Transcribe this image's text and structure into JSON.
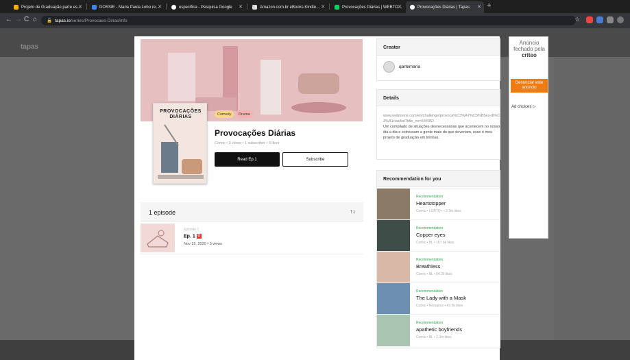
{
  "browser": {
    "tabs": [
      {
        "title": "Projeto de Graduação parte es…",
        "color": "#f4b400"
      },
      {
        "title": "DOSSIE - Maria Paula Lobo re…",
        "color": "#4285f4"
      },
      {
        "title": "especifica - Pesquisa Google",
        "color": "#ffffff"
      },
      {
        "title": "Amazon.com.br eBooks Kindle…",
        "color": "#222222"
      },
      {
        "title": "Provocações Diárias | WEBTO…",
        "color": "#00d564"
      },
      {
        "title": "Provocações Diárias | Tapas",
        "color": "#ffffff"
      }
    ],
    "new_tab": "+",
    "address_host": "tapas.io",
    "address_path": "/series/Provocaes-Dirias/info"
  },
  "series": {
    "genres": [
      "Comedy",
      "Drama"
    ],
    "thumb_title": "PROVOCAÇÕES DIÁRIAS",
    "title": "Provocações Diárias",
    "meta": "Comic • 3 views • 1 subscriber • 0 likes",
    "read_label": "Read Ep.1",
    "subscribe_label": "Subscribe"
  },
  "episodes": {
    "count_label": "1 episode",
    "sort_icon": "↑↓",
    "items": [
      {
        "small": "Episode 1",
        "title": "Ep. 1",
        "badge": "U",
        "date": "Nov 15, 2020 • 3 views"
      }
    ]
  },
  "creator": {
    "heading": "Creator",
    "name": "qartemaria"
  },
  "details": {
    "heading": "Details",
    "url": "www.webtoons.com/en/challenge/provoca%C3%A7%C3%B5es-di%C3%A1rias/list?title_no=544952",
    "description": "Um compilado de situações desnecessárias que acontecem no nosso dia a dia e estressam a gente mais do que deveriam, esse é meu projeto de graduação em tirinhas."
  },
  "recommendations": {
    "heading": "Recommendation for you",
    "items": [
      {
        "label": "Recommendation",
        "title": "Heartstopper",
        "meta": "Comic • LGBTQ+ • 2.3m likes",
        "color": "#8a7a66"
      },
      {
        "label": "Recommendation",
        "title": "Copper eyes",
        "meta": "Comic • BL • 167.6k likes",
        "color": "#3f4d48"
      },
      {
        "label": "Recommendation",
        "title": "Breathless",
        "meta": "Comic • BL • 84.2k likes",
        "color": "#d9b8a8"
      },
      {
        "label": "Recommendation",
        "title": "The Lady with a Mask",
        "meta": "Comic • Romance • 43.5k likes",
        "color": "#6d8fb0"
      },
      {
        "label": "Recommendation",
        "title": "apathetic boyfriends",
        "meta": "Comic • BL • 2.3m likes",
        "color": "#a9c4b0"
      }
    ]
  },
  "ad": {
    "closed_text": "Anúncio fechado pela",
    "brand": "criteo",
    "report_label": "Denunciar este anúncio",
    "choices_label": "Ad choices ▷"
  }
}
